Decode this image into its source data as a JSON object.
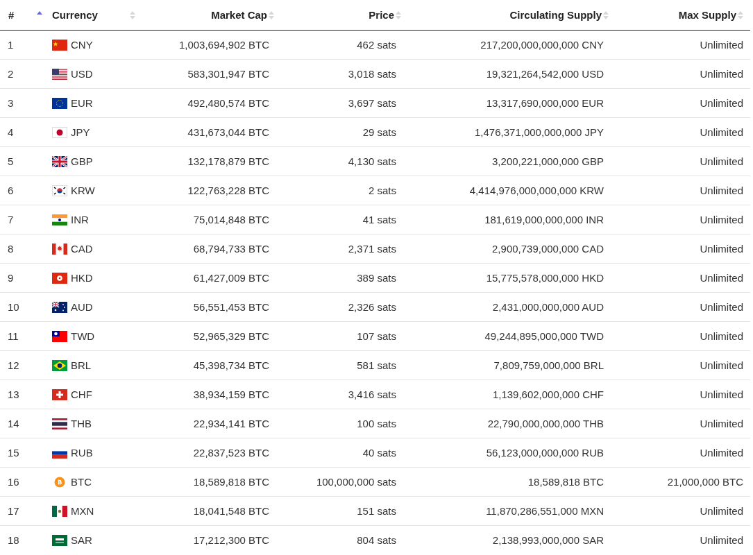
{
  "table": {
    "columns": [
      {
        "label": "#",
        "sorted": true
      },
      {
        "label": "Currency",
        "sorted": false
      },
      {
        "label": "Market Cap",
        "sorted": false
      },
      {
        "label": "Price",
        "sorted": false
      },
      {
        "label": "Circulating Supply",
        "sorted": false
      },
      {
        "label": "Max Supply",
        "sorted": false
      }
    ],
    "rows": [
      {
        "rank": "1",
        "currency": "CNY",
        "market_cap": "1,003,694,902 BTC",
        "price": "462 sats",
        "circulating_supply": "217,200,000,000,000 CNY",
        "max_supply": "Unlimited"
      },
      {
        "rank": "2",
        "currency": "USD",
        "market_cap": "583,301,947 BTC",
        "price": "3,018 sats",
        "circulating_supply": "19,321,264,542,000 USD",
        "max_supply": "Unlimited"
      },
      {
        "rank": "3",
        "currency": "EUR",
        "market_cap": "492,480,574 BTC",
        "price": "3,697 sats",
        "circulating_supply": "13,317,690,000,000 EUR",
        "max_supply": "Unlimited"
      },
      {
        "rank": "4",
        "currency": "JPY",
        "market_cap": "431,673,044 BTC",
        "price": "29 sats",
        "circulating_supply": "1,476,371,000,000,000 JPY",
        "max_supply": "Unlimited"
      },
      {
        "rank": "5",
        "currency": "GBP",
        "market_cap": "132,178,879 BTC",
        "price": "4,130 sats",
        "circulating_supply": "3,200,221,000,000 GBP",
        "max_supply": "Unlimited"
      },
      {
        "rank": "6",
        "currency": "KRW",
        "market_cap": "122,763,228 BTC",
        "price": "2 sats",
        "circulating_supply": "4,414,976,000,000,000 KRW",
        "max_supply": "Unlimited"
      },
      {
        "rank": "7",
        "currency": "INR",
        "market_cap": "75,014,848 BTC",
        "price": "41 sats",
        "circulating_supply": "181,619,000,000,000 INR",
        "max_supply": "Unlimited"
      },
      {
        "rank": "8",
        "currency": "CAD",
        "market_cap": "68,794,733 BTC",
        "price": "2,371 sats",
        "circulating_supply": "2,900,739,000,000 CAD",
        "max_supply": "Unlimited"
      },
      {
        "rank": "9",
        "currency": "HKD",
        "market_cap": "61,427,009 BTC",
        "price": "389 sats",
        "circulating_supply": "15,775,578,000,000 HKD",
        "max_supply": "Unlimited"
      },
      {
        "rank": "10",
        "currency": "AUD",
        "market_cap": "56,551,453 BTC",
        "price": "2,326 sats",
        "circulating_supply": "2,431,000,000,000 AUD",
        "max_supply": "Unlimited"
      },
      {
        "rank": "11",
        "currency": "TWD",
        "market_cap": "52,965,329 BTC",
        "price": "107 sats",
        "circulating_supply": "49,244,895,000,000 TWD",
        "max_supply": "Unlimited"
      },
      {
        "rank": "12",
        "currency": "BRL",
        "market_cap": "45,398,734 BTC",
        "price": "581 sats",
        "circulating_supply": "7,809,759,000,000 BRL",
        "max_supply": "Unlimited"
      },
      {
        "rank": "13",
        "currency": "CHF",
        "market_cap": "38,934,159 BTC",
        "price": "3,416 sats",
        "circulating_supply": "1,139,602,000,000 CHF",
        "max_supply": "Unlimited"
      },
      {
        "rank": "14",
        "currency": "THB",
        "market_cap": "22,934,141 BTC",
        "price": "100 sats",
        "circulating_supply": "22,790,000,000,000 THB",
        "max_supply": "Unlimited"
      },
      {
        "rank": "15",
        "currency": "RUB",
        "market_cap": "22,837,523 BTC",
        "price": "40 sats",
        "circulating_supply": "56,123,000,000,000 RUB",
        "max_supply": "Unlimited"
      },
      {
        "rank": "16",
        "currency": "BTC",
        "market_cap": "18,589,818 BTC",
        "price": "100,000,000 sats",
        "circulating_supply": "18,589,818 BTC",
        "max_supply": "21,000,000 BTC"
      },
      {
        "rank": "17",
        "currency": "MXN",
        "market_cap": "18,041,548 BTC",
        "price": "151 sats",
        "circulating_supply": "11,870,286,551,000 MXN",
        "max_supply": "Unlimited"
      },
      {
        "rank": "18",
        "currency": "SAR",
        "market_cap": "17,212,300 BTC",
        "price": "804 sats",
        "circulating_supply": "2,138,993,000,000 SAR",
        "max_supply": "Unlimited"
      }
    ]
  }
}
